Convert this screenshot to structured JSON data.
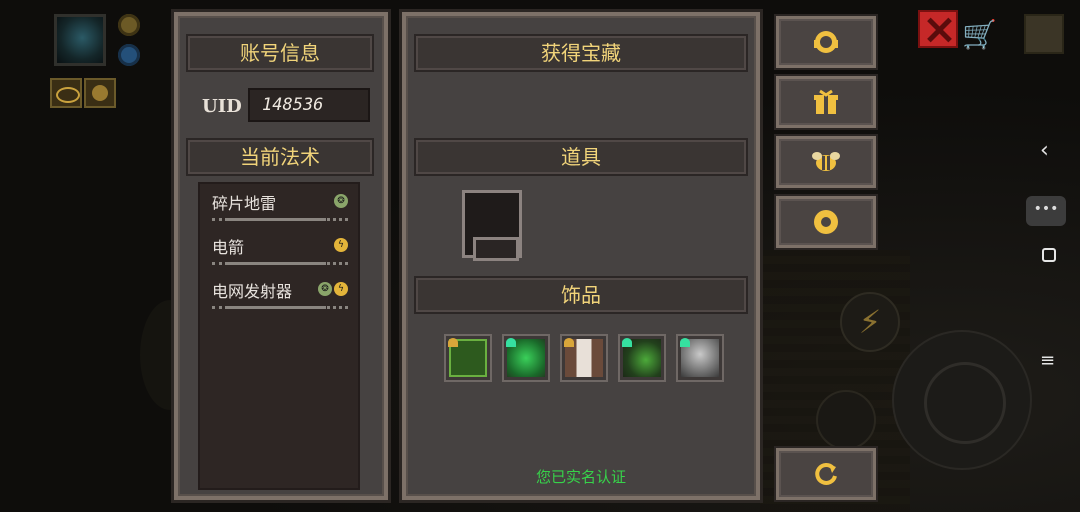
{
  "account_panel": {
    "header": "账号信息",
    "uid_label": "UID",
    "uid_value": "148536",
    "spells_header": "当前法术",
    "spells": [
      {
        "name": "碎片地雷",
        "elements": [
          "earth"
        ]
      },
      {
        "name": "电箭",
        "elements": [
          "electric"
        ]
      },
      {
        "name": "电网发射器",
        "elements": [
          "earth",
          "electric"
        ]
      }
    ]
  },
  "treasure_panel": {
    "header": "获得宝藏",
    "items_header": "道具",
    "accessories_header": "饰品",
    "accessories": [
      {
        "icon": "green-tablet-icon",
        "badge": "gold"
      },
      {
        "icon": "green-clover-icon",
        "badge": "heart"
      },
      {
        "icon": "armor-vest-icon",
        "badge": "gold"
      },
      {
        "icon": "leaf-sprout-icon",
        "badge": "heart"
      },
      {
        "icon": "grey-helmet-icon",
        "badge": "heart"
      }
    ],
    "realname_status": "您已实名认证"
  },
  "right_buttons": [
    {
      "icon": "support-headset-icon"
    },
    {
      "icon": "gift-box-icon"
    },
    {
      "icon": "bee-icon"
    },
    {
      "icon": "settings-gear-icon"
    },
    {
      "icon": "restart-icon"
    }
  ],
  "colors": {
    "panel": "#464241",
    "header_text": "#f1d47a",
    "status_green": "#37d24a",
    "heart": "#36e0a0",
    "gold_badge": "#d9a63a"
  }
}
